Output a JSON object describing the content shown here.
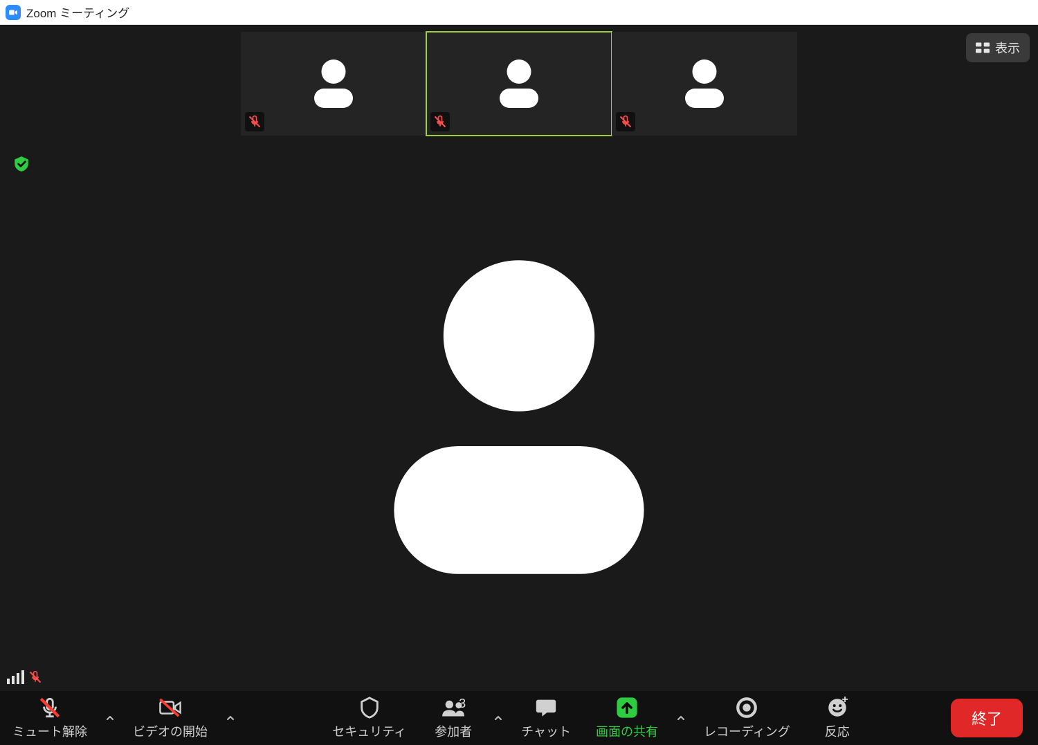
{
  "window": {
    "title": "Zoom ミーティング"
  },
  "view_button": {
    "label": "表示"
  },
  "participants_count": "3",
  "toolbar": {
    "unmute": {
      "label": "ミュート解除"
    },
    "video": {
      "label": "ビデオの開始"
    },
    "security": {
      "label": "セキュリティ"
    },
    "participants": {
      "label": "参加者"
    },
    "chat": {
      "label": "チャット"
    },
    "share": {
      "label": "画面の共有"
    },
    "record": {
      "label": "レコーディング"
    },
    "reaction": {
      "label": "反応"
    },
    "end": {
      "label": "終了"
    }
  }
}
